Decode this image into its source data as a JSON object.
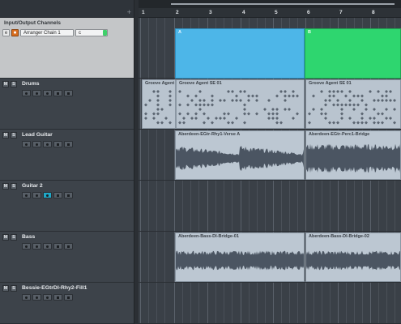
{
  "io_channels": {
    "title": "Input/Output Channels",
    "e_label": "e",
    "orange_label": "⏺",
    "chain": "Arranger Chain 1",
    "c_value": "c"
  },
  "ruler": {
    "bars": [
      "1",
      "2",
      "3",
      "4",
      "5",
      "6",
      "7",
      "8"
    ]
  },
  "plus_icon": "+",
  "tracks": [
    {
      "name": "Drums",
      "m": "M",
      "s": "S"
    },
    {
      "name": "Lead Guitar",
      "m": "M",
      "s": "S"
    },
    {
      "name": "Guitar 2",
      "m": "M",
      "s": "S"
    },
    {
      "name": "Bass",
      "m": "M",
      "s": "S"
    },
    {
      "name": "Bessie-EGtrDI-Rhy2-Fill1",
      "m": "M",
      "s": "S"
    }
  ],
  "arranger": [
    {
      "label": "A",
      "color": "#4db6e8"
    },
    {
      "label": "B",
      "color": "#2ed66f"
    }
  ],
  "events": {
    "drums": [
      "Groove Agent",
      "Groove Agent SE 01",
      "Groove Agent SE 01"
    ],
    "lead": [
      "Aberdeen-EGtr-Rhy1-Verse A",
      "Aberdeen-EGtr-Perc1-Bridge"
    ],
    "bass": [
      "Aberdeen-Bass-DI-Bridge-01",
      "Aberdeen-Bass-DI-Bridge-02"
    ]
  },
  "colors": {
    "panel": "#3d434a",
    "io_bg": "#c4c6c8",
    "event": "#bcc7d2",
    "teal": "#1fa8c7",
    "orange": "#d86d1e"
  }
}
